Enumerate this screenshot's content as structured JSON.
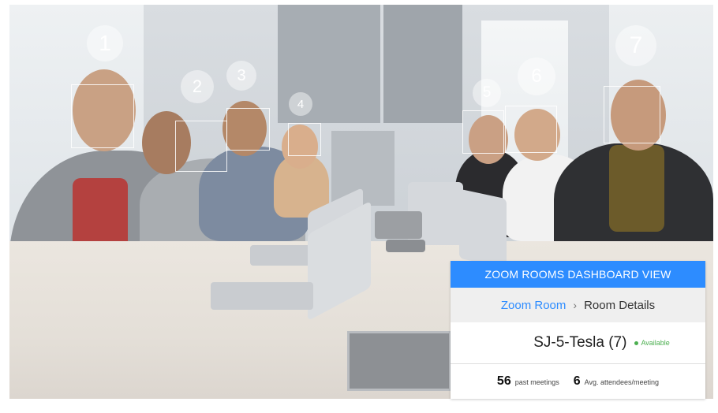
{
  "face_markers": [
    "1",
    "2",
    "3",
    "4",
    "5",
    "6",
    "7"
  ],
  "panel": {
    "header": "ZOOM ROOMS DASHBOARD VIEW",
    "breadcrumb": {
      "link": "Zoom Room",
      "separator": "›",
      "current": "Room Details"
    },
    "room": {
      "name": "SJ-5-Tesla (7)",
      "status": "Available"
    },
    "stats": [
      {
        "value": "56",
        "label": "past meetings"
      },
      {
        "value": "6",
        "label": "Avg. attendees/meeting"
      }
    ]
  },
  "colors": {
    "header": "#2d8cff",
    "link": "#2d8cff",
    "available": "#4caf50"
  }
}
